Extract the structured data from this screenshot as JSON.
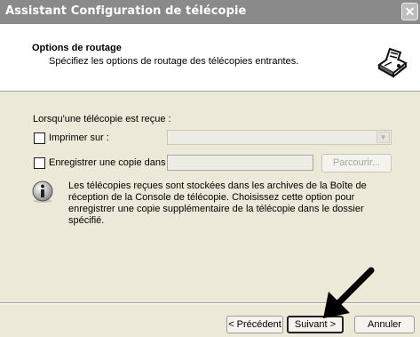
{
  "window": {
    "title": "Assistant Configuration de télécopie",
    "close_glyph": "✕"
  },
  "header": {
    "title": "Options de routage",
    "subtitle": "Spécifiez les options de routage des télécopies entrantes.",
    "icon": "fax-machine-icon"
  },
  "form": {
    "intro_label": "Lorsqu'une télécopie est reçue :",
    "print_label": "Imprimer sur :",
    "print_checked": false,
    "printer_value": "",
    "save_copy_label": "Enregistrer une copie dans :",
    "save_copy_checked": false,
    "folder_value": "",
    "browse_label": "Parcourir...",
    "info_text": "Les télécopies reçues sont stockées dans les archives de la Boîte de réception de la Console de télécopie. Choisissez cette option pour enregistrer une copie supplémentaire de la télécopie dans le dossier spécifié."
  },
  "footer": {
    "back_label": "< Précédent",
    "next_label": "Suivant >",
    "cancel_label": "Annuler"
  },
  "annotation": {
    "icon": "arrow-pointer-icon",
    "color": "#000000"
  }
}
